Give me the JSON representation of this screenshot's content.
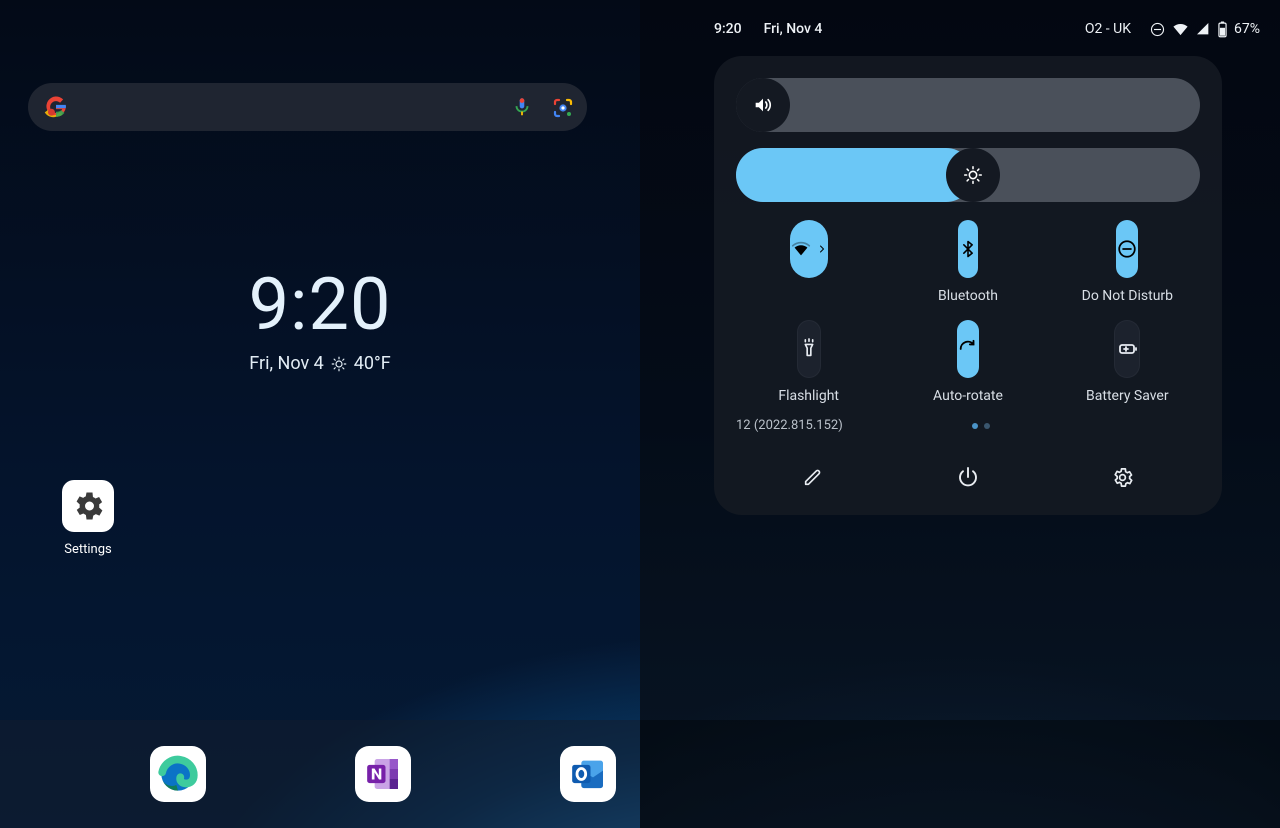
{
  "left": {
    "clock_time": "9:20",
    "clock_date": "Fri, Nov 4",
    "weather_temp": "40°F",
    "home_icons": {
      "settings_label": "Settings"
    },
    "dock": [
      "edge",
      "onenote",
      "outlook"
    ]
  },
  "right": {
    "status": {
      "time": "9:20",
      "date": "Fri, Nov 4",
      "carrier": "O2 - UK",
      "battery_pct": "67%"
    },
    "sliders": {
      "volume_pct": 0,
      "brightness_pct": 51
    },
    "tiles": [
      {
        "id": "wifi",
        "label": "",
        "on": true,
        "icon": "wifi"
      },
      {
        "id": "bluetooth",
        "label": "Bluetooth",
        "on": true,
        "icon": "bluetooth"
      },
      {
        "id": "dnd",
        "label": "Do Not Disturb",
        "on": true,
        "icon": "dnd"
      },
      {
        "id": "flashlight",
        "label": "Flashlight",
        "on": false,
        "icon": "flashlight"
      },
      {
        "id": "autorotate",
        "label": "Auto-rotate",
        "on": true,
        "icon": "autorotate"
      },
      {
        "id": "batterysaver",
        "label": "Battery Saver",
        "on": false,
        "icon": "batterysaver"
      }
    ],
    "version": "12 (2022.815.152)"
  }
}
